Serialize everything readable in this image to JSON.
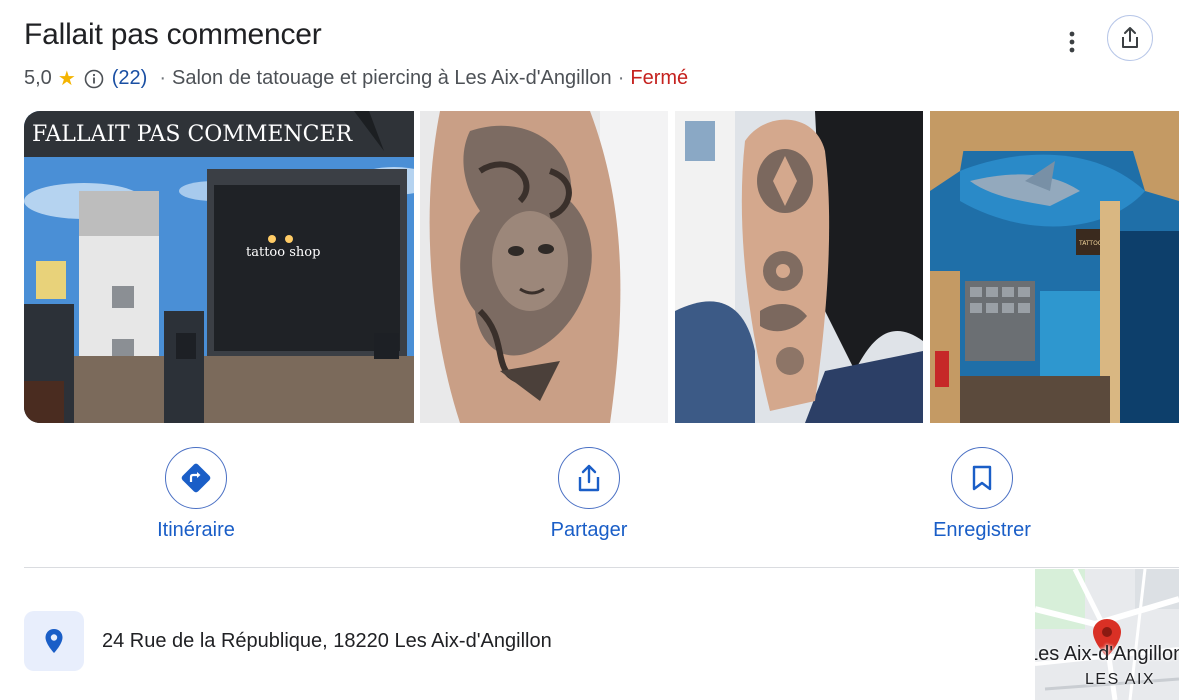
{
  "place": {
    "name": "Fallait pas commencer",
    "rating": "5,0",
    "review_count": "(22)",
    "category": "Salon de tatouage et piercing à Les Aix-d'Angillon",
    "separator": "·",
    "status": "Fermé",
    "status_color": "#c5221f"
  },
  "photos": {
    "storefront_sign": "FALLAIT PAS COMMENCER",
    "window_text": "tattoo shop",
    "interior_sign": "TATTOO SHOP"
  },
  "icons": {
    "star": "★",
    "info": "info-icon",
    "more": "more-vert-icon",
    "share": "share-icon",
    "directions": "directions-icon",
    "bookmark": "bookmark-icon",
    "location": "location-pin-icon"
  },
  "actions": {
    "directions_label": "Itinéraire",
    "share_label": "Partager",
    "save_label": "Enregistrer"
  },
  "address": "24 Rue de la République, 18220 Les Aix-d'Angillon",
  "map": {
    "town_label": "Les Aix-d'Angillon",
    "sub_label": "LES AIX"
  },
  "colors": {
    "accent": "#1a5ec7",
    "star": "#f4b400"
  }
}
